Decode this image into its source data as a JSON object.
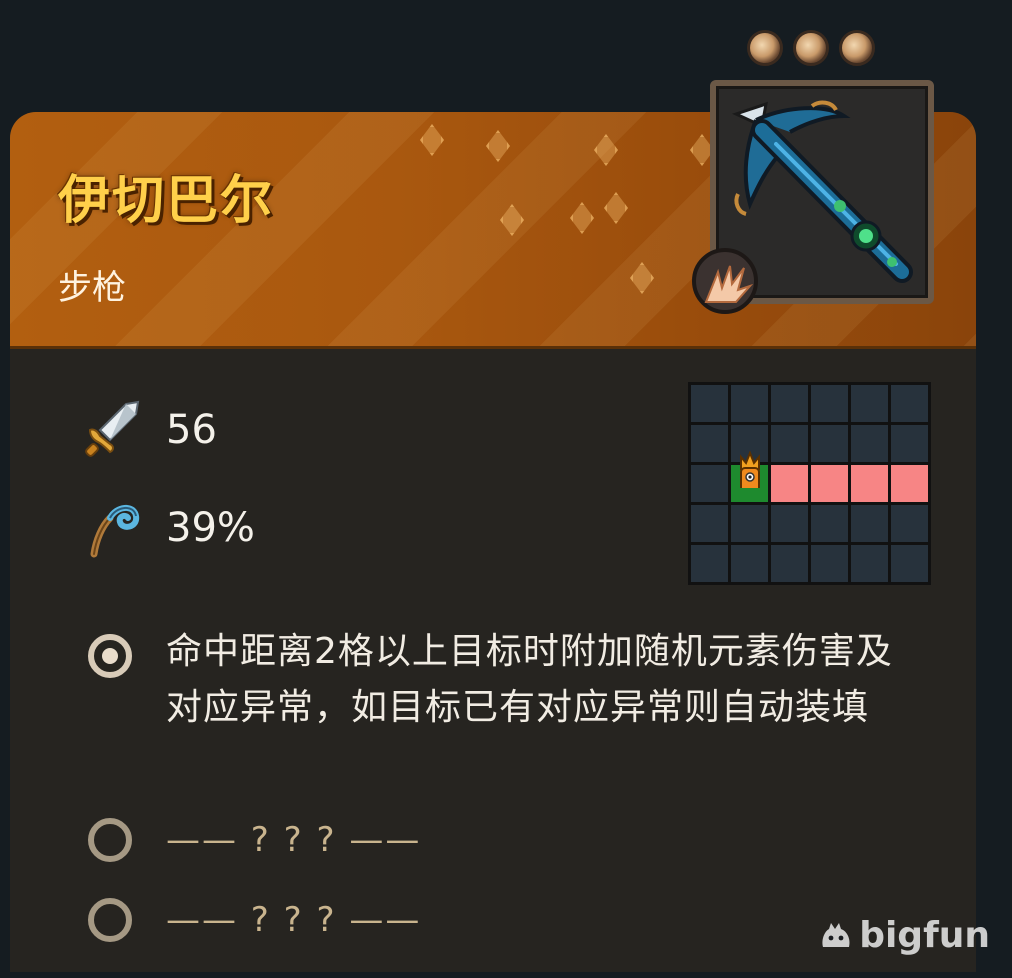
{
  "item": {
    "name": "伊切巴尔",
    "type": "步枪",
    "upgrade_slots": 3
  },
  "stats": [
    {
      "icon": "sword-icon",
      "value": "56"
    },
    {
      "icon": "staff-icon",
      "value": "39%"
    }
  ],
  "range_grid": {
    "rows": 5,
    "cols": 6,
    "self_cell": [
      2,
      1
    ],
    "range_cells": [
      [
        2,
        2
      ],
      [
        2,
        3
      ],
      [
        2,
        4
      ],
      [
        2,
        5
      ]
    ]
  },
  "perks": [
    {
      "state": "unlocked",
      "text": "命中距离2格以上目标时附加随机元素伤害及对应异常，如目标已有对应异常则自动装填"
    },
    {
      "state": "locked",
      "text": "—— ? ? ? ——"
    },
    {
      "state": "locked",
      "text": "—— ? ? ? ——"
    }
  ],
  "watermark": "bigfun",
  "colors": {
    "header": "#a9580f",
    "title": "#ffd04a",
    "range": "#f78585",
    "self": "#1e8a2e",
    "grid_cell": "#27323c",
    "panel": "#262420"
  }
}
